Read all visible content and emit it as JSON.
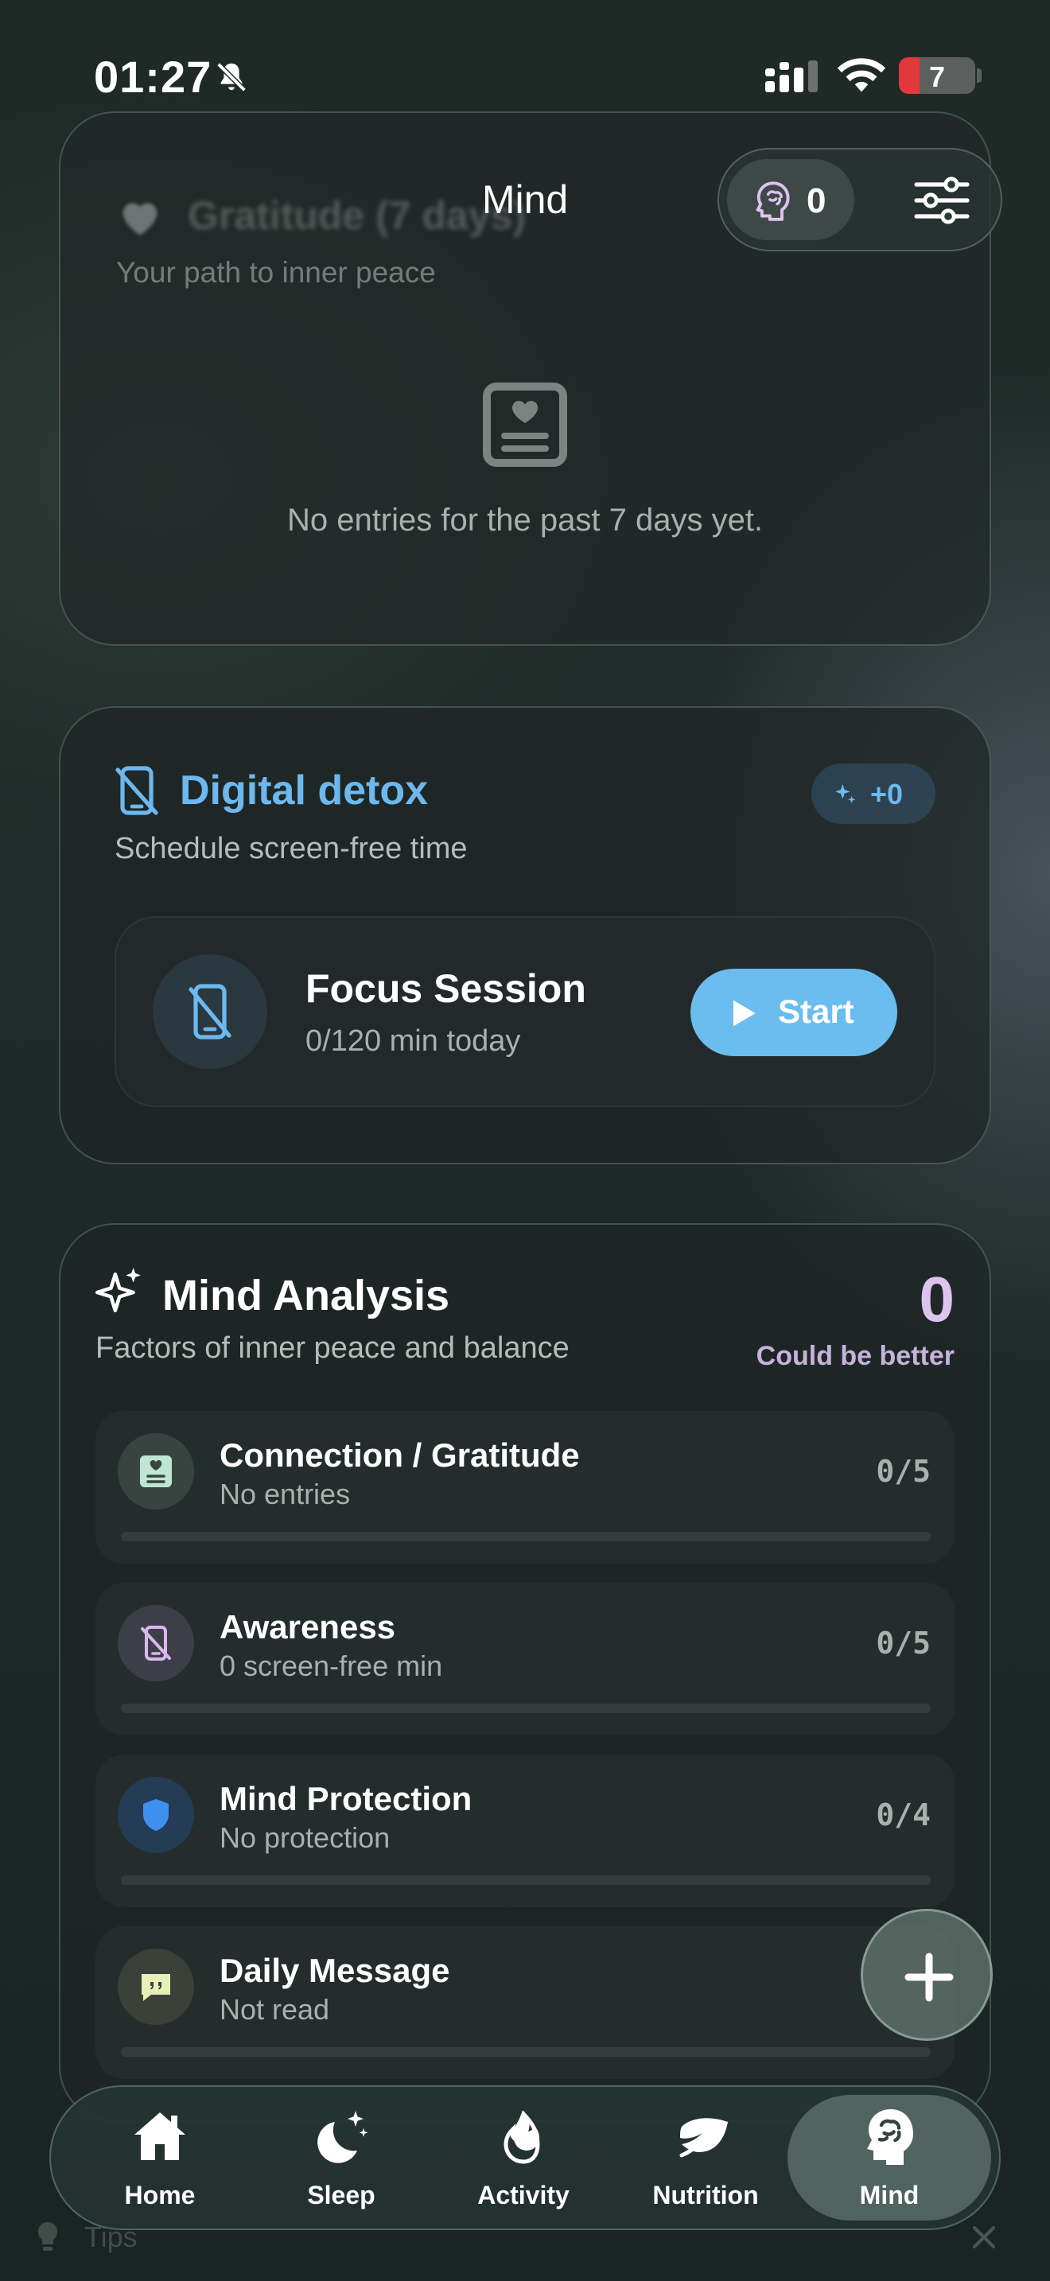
{
  "status_bar": {
    "time": "01:27",
    "battery": "7"
  },
  "header": {
    "title": "Mind",
    "brain_points": "0"
  },
  "gratitude": {
    "title": "Gratitude (7 days)",
    "subtitle": "Your path to inner peace",
    "empty_text": "No entries for the past 7 days yet."
  },
  "detox": {
    "title": "Digital detox",
    "subtitle": "Schedule screen-free time",
    "bonus": "+0",
    "focus_title": "Focus Session",
    "focus_sub": "0/120 min today",
    "start_label": "Start"
  },
  "analysis": {
    "title": "Mind Analysis",
    "subtitle": "Factors of inner peace and balance",
    "score": "0",
    "score_label": "Could be better",
    "factors": [
      {
        "name": "Connection / Gratitude",
        "sub": "No entries",
        "score": "0/5",
        "icon": "journal-heart-icon",
        "progress": 0
      },
      {
        "name": "Awareness",
        "sub": "0 screen-free min",
        "score": "0/5",
        "icon": "phone-off-icon",
        "progress": 0
      },
      {
        "name": "Mind Protection",
        "sub": "No protection",
        "score": "0/4",
        "icon": "shield-icon",
        "progress": 0
      },
      {
        "name": "Daily Message",
        "sub": "Not read",
        "score": "",
        "icon": "quote-bubble-icon",
        "progress": 0
      }
    ]
  },
  "tabs": [
    {
      "label": "Home",
      "icon": "home-icon"
    },
    {
      "label": "Sleep",
      "icon": "moon-stars-icon"
    },
    {
      "label": "Activity",
      "icon": "flame-icon"
    },
    {
      "label": "Nutrition",
      "icon": "leaf-icon"
    },
    {
      "label": "Mind",
      "icon": "brain-head-icon",
      "active": true
    }
  ],
  "tips": {
    "label": "Tips"
  },
  "colors": {
    "accent_blue": "#6bbcef",
    "accent_purple": "#dcc4ef",
    "shield_blue": "#3f8ff0"
  }
}
